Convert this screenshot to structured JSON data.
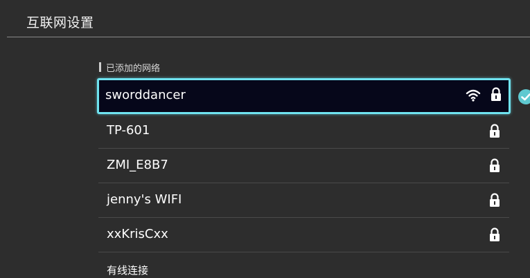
{
  "header": {
    "title": "互联网设置"
  },
  "section": {
    "label": "已添加的网络"
  },
  "networks": [
    {
      "name": "sworddancer",
      "connected": true,
      "icons": [
        "wifi-icon",
        "lock-icon"
      ]
    },
    {
      "name": "TP-601",
      "connected": false,
      "icons": [
        "lock-icon"
      ]
    },
    {
      "name": "ZMI_E8B7",
      "connected": false,
      "icons": [
        "lock-icon"
      ]
    },
    {
      "name": "jenny's WIFI",
      "connected": false,
      "icons": [
        "lock-icon"
      ]
    },
    {
      "name": "xxKrisCxx",
      "connected": false,
      "icons": [
        "lock-icon"
      ]
    }
  ],
  "wired": {
    "label": "有线连接"
  },
  "colors": {
    "background": "#2d2d2d",
    "selection_border": "#6fe3f0",
    "selection_fill": "#06071a",
    "connected_check": "#5fc9d0"
  }
}
